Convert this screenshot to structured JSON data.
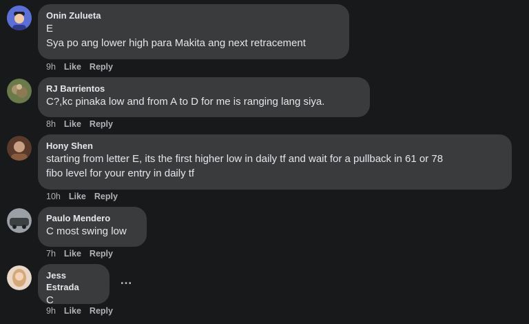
{
  "comments": [
    {
      "author": "Onin Zulueta",
      "lines": [
        "E",
        "Sya po ang lower high para Makita ang next retracement"
      ],
      "time": "9h",
      "like": "Like",
      "reply": "Reply"
    },
    {
      "author": "RJ Barrientos",
      "lines": [
        "C?,kc pinaka low and from A to D for me is ranging lang siya."
      ],
      "time": "8h",
      "like": "Like",
      "reply": "Reply"
    },
    {
      "author": "Hony Shen",
      "lines": [
        "starting from letter E, its the first higher low in daily tf and wait for a pullback in 61 or 78",
        "fibo level for your entry in daily tf"
      ],
      "time": "10h",
      "like": "Like",
      "reply": "Reply"
    },
    {
      "author": "Paulo Mendero",
      "lines": [
        "C most swing low"
      ],
      "time": "7h",
      "like": "Like",
      "reply": "Reply"
    },
    {
      "author": "Jess Estrada",
      "lines": [
        "C"
      ],
      "time": "9h",
      "like": "Like",
      "reply": "Reply"
    }
  ],
  "more_icon": "…"
}
